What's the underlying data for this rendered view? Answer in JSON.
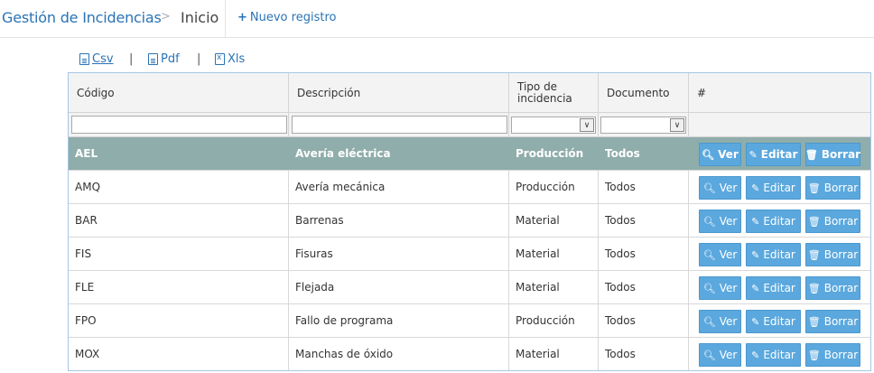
{
  "header": {
    "brand": "Gestión de Incidencias",
    "separator": ">",
    "crumb": "Inicio",
    "new_plus": "+",
    "new_label": "Nuevo registro"
  },
  "exports": {
    "csv": "Csv",
    "pdf": "Pdf",
    "xls": "Xls",
    "sep": "|"
  },
  "grid": {
    "columns": [
      "Código",
      "Descripción",
      "Tipo de incidencia",
      "Documento",
      "#"
    ],
    "buttons": {
      "view": "Ver",
      "edit": "Editar",
      "delete": "Borrar"
    },
    "rows": [
      {
        "code": "AEL",
        "desc": "Avería eléctrica",
        "type": "Producción",
        "doc": "Todos",
        "selected": true
      },
      {
        "code": "AMQ",
        "desc": "Avería mecánica",
        "type": "Producción",
        "doc": "Todos"
      },
      {
        "code": "BAR",
        "desc": "Barrenas",
        "type": "Material",
        "doc": "Todos"
      },
      {
        "code": "FIS",
        "desc": "Fisuras",
        "type": "Material",
        "doc": "Todos"
      },
      {
        "code": "FLE",
        "desc": "Flejada",
        "type": "Material",
        "doc": "Todos"
      },
      {
        "code": "FPO",
        "desc": "Fallo de programa",
        "type": "Producción",
        "doc": "Todos"
      },
      {
        "code": "MOX",
        "desc": "Manchas de óxido",
        "type": "Material",
        "doc": "Todos"
      }
    ]
  },
  "colors": {
    "brand": "#2a73b5",
    "selected_row": "#8fadaa",
    "action_button": "#5ba8de"
  },
  "icons": {
    "view": "search-icon",
    "edit": "pencil-icon",
    "delete": "trash-icon",
    "export_csv": "file-text-icon",
    "export_pdf": "file-pdf-icon",
    "export_xls": "file-excel-icon",
    "dropdown": "chevron-down-icon"
  }
}
